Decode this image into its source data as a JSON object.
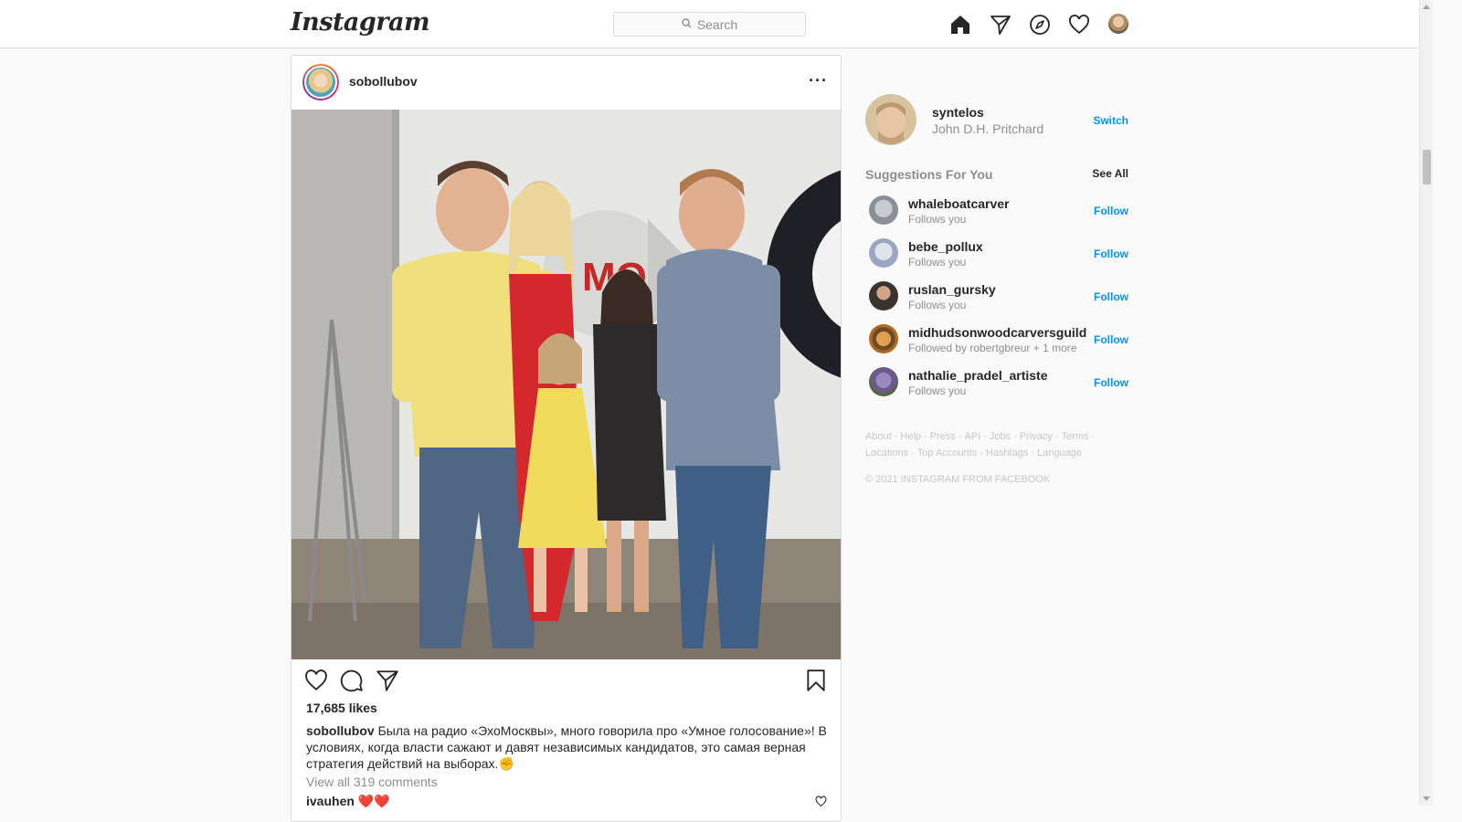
{
  "header": {
    "logo": "Instagram",
    "search_placeholder": "Search",
    "icons": [
      "home-icon",
      "direct-icon",
      "explore-icon",
      "activity-icon",
      "profile-avatar"
    ]
  },
  "post": {
    "username": "sobollubov",
    "likes": "17,685 likes",
    "caption_user": "sobollubov",
    "caption_text": "Была на радио «ЭхоМосквы», много говорила про «Умное голосование»! В условиях, когда власти сажают и давят независимых кандидатов, это самая верная стратегия действий на выборах.✊",
    "view_comments": "View all 319 comments",
    "comment_user": "ivauhen",
    "comment_text": "❤️❤️"
  },
  "sidebar": {
    "username": "syntelos",
    "full_name": "John D.H. Pritchard",
    "switch_label": "Switch",
    "suggestions_title": "Suggestions For You",
    "see_all_label": "See All",
    "suggestions": [
      {
        "name": "whaleboatcarver",
        "sub": "Follows you",
        "action": "Follow",
        "color": "#8a8f98"
      },
      {
        "name": "bebe_pollux",
        "sub": "Follows you",
        "action": "Follow",
        "color": "#9aa7c0"
      },
      {
        "name": "ruslan_gursky",
        "sub": "Follows you",
        "action": "Follow",
        "color": "#3a3430"
      },
      {
        "name": "midhudsonwoodcarversguild",
        "sub": "Followed by robertgbreur + 1 more",
        "action": "Follow",
        "color": "#b5651d"
      },
      {
        "name": "nathalie_pradel_artiste",
        "sub": "Follows you",
        "action": "Follow",
        "color": "#6c5a8a"
      }
    ],
    "footer_links": [
      "About",
      "Help",
      "Press",
      "API",
      "Jobs",
      "Privacy",
      "Terms",
      "Locations",
      "Top Accounts",
      "Hashtags",
      "Language"
    ],
    "copyright": "© 2021 INSTAGRAM FROM FACEBOOK"
  },
  "colors": {
    "accent": "#0095f6",
    "muted": "#8e8e8e",
    "border": "#dbdbdb"
  }
}
